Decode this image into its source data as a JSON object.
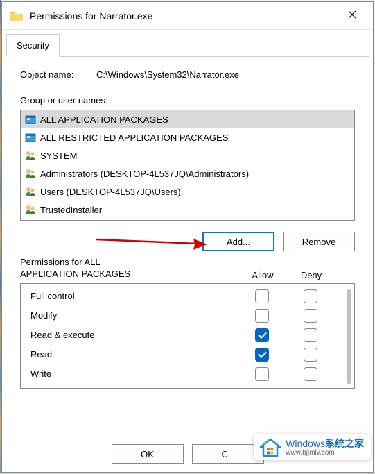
{
  "window_title": "Permissions for Narrator.exe",
  "tab_label": "Security",
  "object_name_label": "Object name:",
  "object_name_value": "C:\\Windows\\System32\\Narrator.exe",
  "group_label": "Group or user names:",
  "principals": [
    {
      "name": "ALL APPLICATION PACKAGES",
      "icon": "package",
      "selected": true
    },
    {
      "name": "ALL RESTRICTED APPLICATION PACKAGES",
      "icon": "package",
      "selected": false
    },
    {
      "name": "SYSTEM",
      "icon": "users",
      "selected": false
    },
    {
      "name": "Administrators (DESKTOP-4L537JQ\\Administrators)",
      "icon": "users",
      "selected": false
    },
    {
      "name": "Users (DESKTOP-4L537JQ\\Users)",
      "icon": "users",
      "selected": false
    },
    {
      "name": "TrustedInstaller",
      "icon": "users",
      "selected": false
    }
  ],
  "add_label": "Add...",
  "remove_label": "Remove",
  "perm_title_line1": "Permissions for ALL",
  "perm_title_line2": "APPLICATION PACKAGES",
  "allow_label": "Allow",
  "deny_label": "Deny",
  "permissions": [
    {
      "name": "Full control",
      "allow": false,
      "deny": false
    },
    {
      "name": "Modify",
      "allow": false,
      "deny": false
    },
    {
      "name": "Read & execute",
      "allow": true,
      "deny": false
    },
    {
      "name": "Read",
      "allow": true,
      "deny": false
    },
    {
      "name": "Write",
      "allow": false,
      "deny": false
    }
  ],
  "ok_label": "OK",
  "cancel_label": "C",
  "watermark": {
    "brand": "Windows",
    "suffix": "系统之家",
    "url": "www.bjjmlv.com"
  }
}
